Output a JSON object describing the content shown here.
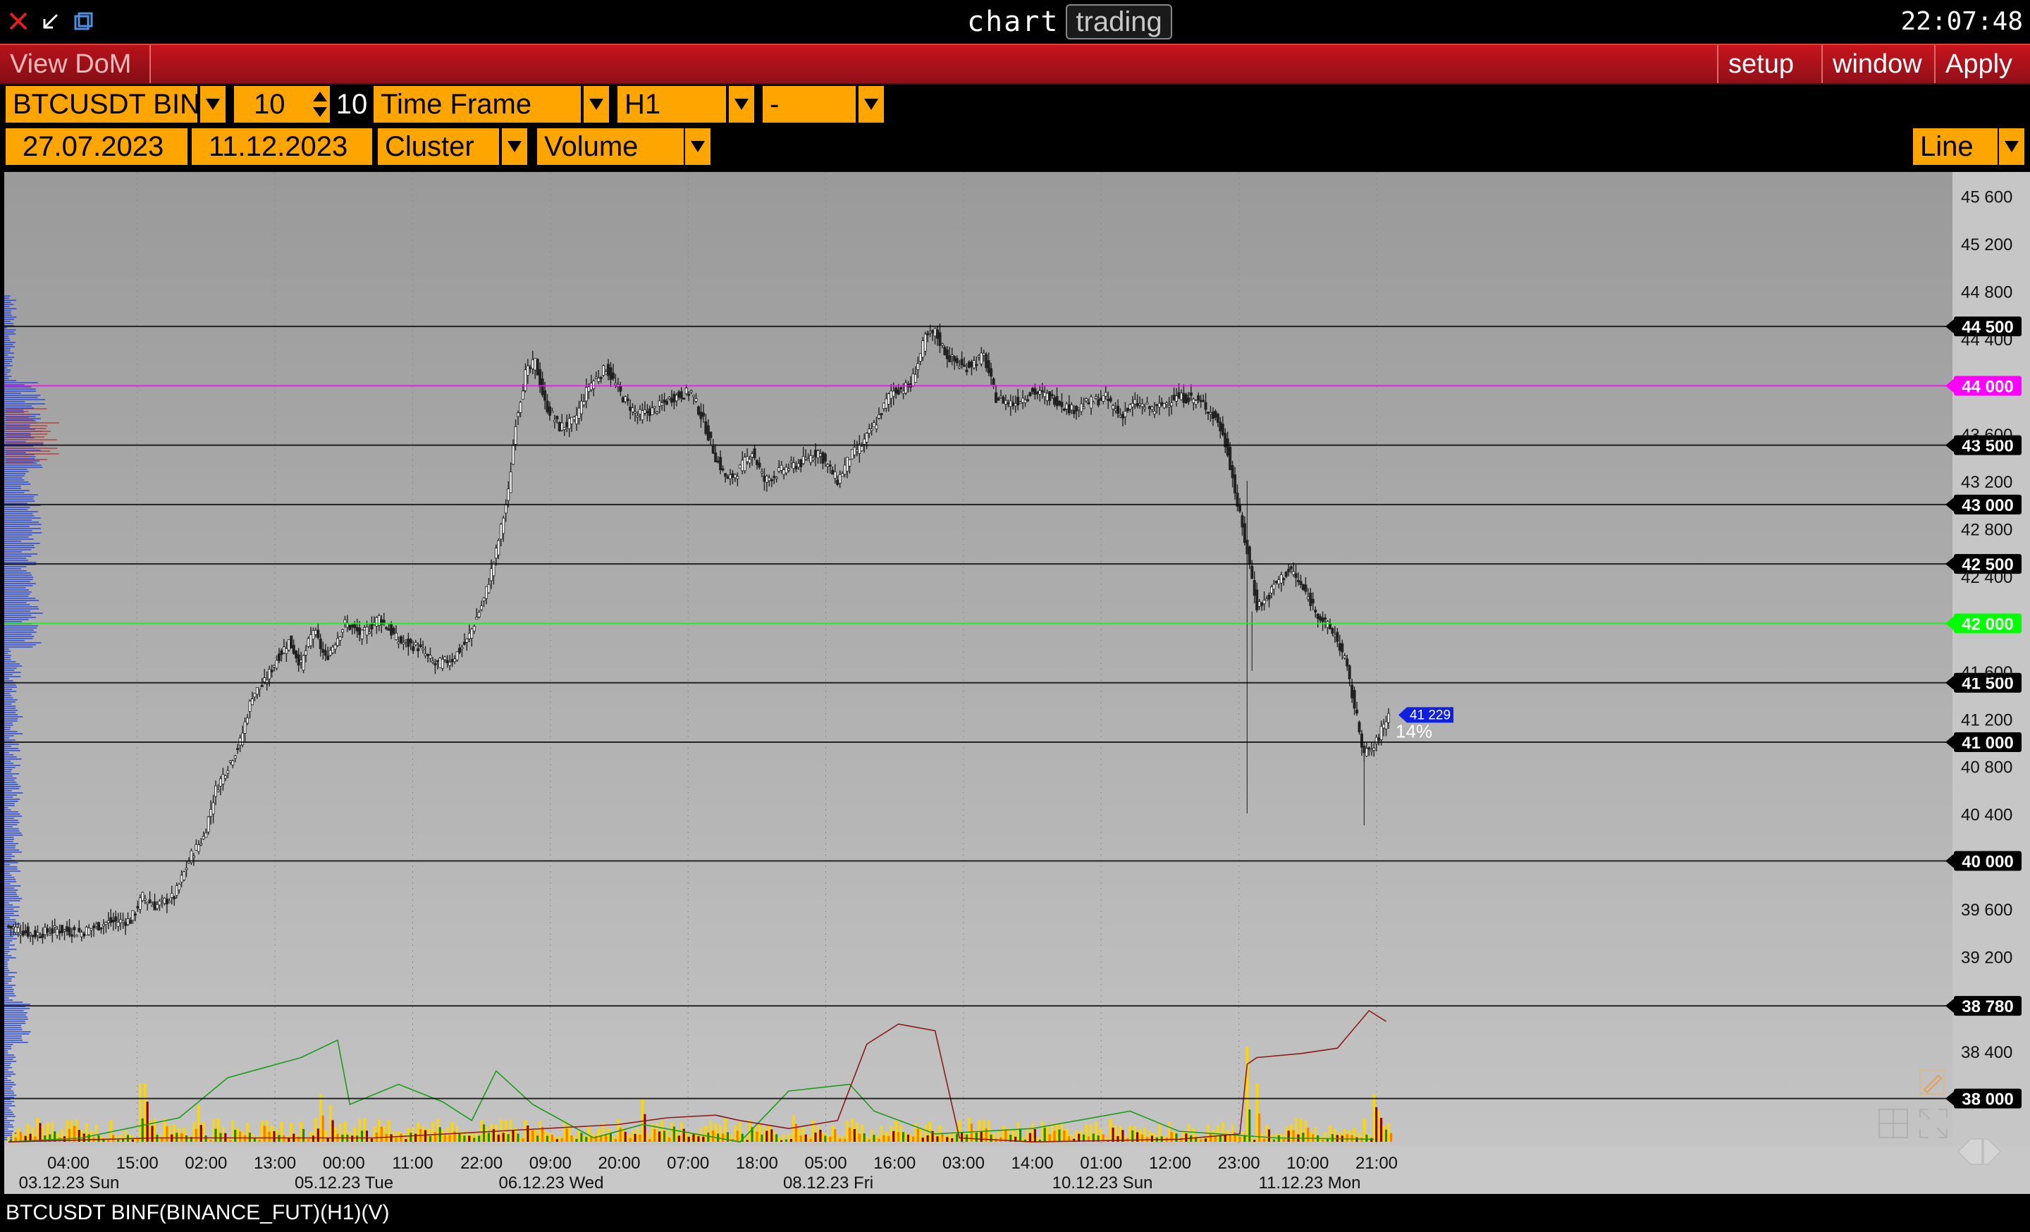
{
  "titlebar": {
    "app_name": "chart",
    "mode_label": "trading",
    "clock": "22:07:48"
  },
  "menubar": {
    "view_dom": "View DoM",
    "setup": "setup",
    "window": "window",
    "apply": "Apply"
  },
  "controls": {
    "symbol": "BTCUSDT BIN",
    "count_value": "10",
    "count_label": "10",
    "timeframe_label": "Time Frame",
    "timeframe_value": "H1",
    "extra_value": "-",
    "date_from": "27.07.2023",
    "date_to": "11.12.2023",
    "chart_type": "Cluster",
    "cluster_mode": "Volume",
    "draw_mode": "Line"
  },
  "status": {
    "caption": "BTCUSDT BINF(BINANCE_FUT)(H1)(V)"
  },
  "chart_data": {
    "type": "candlestick",
    "ylim": [
      37600,
      45800
    ],
    "price_ticks": [
      "45 600",
      "45 200",
      "44 800",
      "44 400",
      "43 600",
      "43 200",
      "42 800",
      "42 400",
      "41 600",
      "41 200",
      "40 800",
      "40 400",
      "39 600",
      "39 200",
      "38 400"
    ],
    "levels": [
      {
        "label": "44 500",
        "value": 44500,
        "color": "#000000"
      },
      {
        "label": "44 000",
        "value": 44000,
        "color": "#ff00ff"
      },
      {
        "label": "43 500",
        "value": 43500,
        "color": "#000000"
      },
      {
        "label": "43 000",
        "value": 43000,
        "color": "#000000"
      },
      {
        "label": "42 500",
        "value": 42500,
        "color": "#000000"
      },
      {
        "label": "42 000",
        "value": 42000,
        "color": "#00ff00"
      },
      {
        "label": "41 500",
        "value": 41500,
        "color": "#000000"
      },
      {
        "label": "41 000",
        "value": 41000,
        "color": "#000000"
      },
      {
        "label": "40 000",
        "value": 40000,
        "color": "#000000"
      },
      {
        "label": "38 780",
        "value": 38780,
        "color": "#000000"
      },
      {
        "label": "38 000",
        "value": 38000,
        "color": "#000000"
      }
    ],
    "current_price_label": "41 229",
    "current_price": 41229,
    "current_pct": "14%",
    "time_ticks": [
      "04:00",
      "15:00",
      "02:00",
      "13:00",
      "00:00",
      "11:00",
      "22:00",
      "09:00",
      "20:00",
      "07:00",
      "18:00",
      "05:00",
      "16:00",
      "03:00",
      "14:00",
      "01:00",
      "12:00",
      "23:00",
      "10:00",
      "21:00"
    ],
    "date_labels": [
      "03.12.23 Sun",
      "05.12.23 Tue",
      "06.12.23 Wed",
      "08.12.23 Fri",
      "10.12.23 Sun",
      "11.12.23 Mon"
    ],
    "close_path": [
      [
        0,
        39450
      ],
      [
        10,
        39380
      ],
      [
        20,
        39420
      ],
      [
        30,
        39400
      ],
      [
        40,
        39480
      ],
      [
        50,
        39500
      ],
      [
        55,
        39700
      ],
      [
        60,
        39620
      ],
      [
        68,
        39700
      ],
      [
        75,
        40050
      ],
      [
        80,
        40200
      ],
      [
        85,
        40600
      ],
      [
        90,
        40800
      ],
      [
        95,
        41000
      ],
      [
        100,
        41400
      ],
      [
        105,
        41500
      ],
      [
        110,
        41700
      ],
      [
        115,
        41850
      ],
      [
        120,
        41650
      ],
      [
        125,
        41950
      ],
      [
        130,
        41700
      ],
      [
        138,
        42000
      ],
      [
        145,
        41900
      ],
      [
        152,
        42050
      ],
      [
        160,
        41850
      ],
      [
        168,
        41800
      ],
      [
        175,
        41650
      ],
      [
        182,
        41700
      ],
      [
        188,
        41850
      ],
      [
        195,
        42200
      ],
      [
        200,
        42600
      ],
      [
        205,
        43100
      ],
      [
        208,
        43700
      ],
      [
        212,
        44100
      ],
      [
        216,
        44200
      ],
      [
        220,
        43850
      ],
      [
        226,
        43650
      ],
      [
        232,
        43700
      ],
      [
        238,
        44000
      ],
      [
        245,
        44150
      ],
      [
        252,
        43900
      ],
      [
        258,
        43750
      ],
      [
        265,
        43800
      ],
      [
        272,
        43900
      ],
      [
        280,
        43950
      ],
      [
        285,
        43700
      ],
      [
        290,
        43400
      ],
      [
        295,
        43200
      ],
      [
        300,
        43300
      ],
      [
        305,
        43450
      ],
      [
        310,
        43200
      ],
      [
        318,
        43300
      ],
      [
        325,
        43350
      ],
      [
        332,
        43450
      ],
      [
        340,
        43200
      ],
      [
        345,
        43400
      ],
      [
        350,
        43500
      ],
      [
        356,
        43700
      ],
      [
        362,
        43950
      ],
      [
        370,
        44000
      ],
      [
        376,
        44400
      ],
      [
        380,
        44450
      ],
      [
        385,
        44250
      ],
      [
        392,
        44150
      ],
      [
        400,
        44250
      ],
      [
        405,
        43900
      ],
      [
        412,
        43850
      ],
      [
        420,
        43950
      ],
      [
        428,
        43900
      ],
      [
        436,
        43800
      ],
      [
        442,
        43850
      ],
      [
        450,
        43900
      ],
      [
        456,
        43750
      ],
      [
        462,
        43850
      ],
      [
        470,
        43800
      ],
      [
        478,
        43900
      ],
      [
        484,
        43900
      ],
      [
        490,
        43850
      ],
      [
        496,
        43700
      ],
      [
        500,
        43450
      ],
      [
        504,
        43000
      ],
      [
        508,
        42600
      ],
      [
        512,
        42150
      ],
      [
        516,
        42200
      ],
      [
        520,
        42350
      ],
      [
        526,
        42450
      ],
      [
        532,
        42250
      ],
      [
        538,
        42050
      ],
      [
        544,
        41900
      ],
      [
        548,
        41700
      ],
      [
        552,
        41300
      ],
      [
        556,
        40900
      ],
      [
        560,
        40950
      ],
      [
        564,
        41150
      ],
      [
        566,
        41229
      ]
    ],
    "volume_spikes": [
      [
        55,
        0.55
      ],
      [
        78,
        0.35
      ],
      [
        128,
        0.45
      ],
      [
        132,
        0.35
      ],
      [
        260,
        0.4
      ],
      [
        322,
        0.25
      ],
      [
        330,
        0.2
      ],
      [
        508,
        0.9
      ],
      [
        512,
        0.55
      ],
      [
        560,
        0.45
      ],
      [
        562,
        0.3
      ]
    ],
    "delta_green": [
      [
        0,
        0.02
      ],
      [
        30,
        0.05
      ],
      [
        70,
        0.2
      ],
      [
        90,
        0.5
      ],
      [
        120,
        0.65
      ],
      [
        135,
        0.78
      ],
      [
        140,
        0.3
      ],
      [
        160,
        0.45
      ],
      [
        178,
        0.32
      ],
      [
        190,
        0.18
      ],
      [
        200,
        0.55
      ],
      [
        215,
        0.3
      ],
      [
        240,
        0.05
      ],
      [
        260,
        0.15
      ],
      [
        300,
        0.02
      ],
      [
        320,
        0.4
      ],
      [
        345,
        0.45
      ],
      [
        355,
        0.25
      ],
      [
        380,
        0.08
      ],
      [
        420,
        0.12
      ],
      [
        460,
        0.25
      ],
      [
        480,
        0.1
      ],
      [
        520,
        0.05
      ],
      [
        560,
        0.04
      ]
    ],
    "delta_red": [
      [
        0,
        0.02
      ],
      [
        60,
        0.05
      ],
      [
        150,
        0.05
      ],
      [
        250,
        0.15
      ],
      [
        270,
        0.2
      ],
      [
        290,
        0.22
      ],
      [
        300,
        0.18
      ],
      [
        320,
        0.12
      ],
      [
        340,
        0.18
      ],
      [
        352,
        0.75
      ],
      [
        365,
        0.9
      ],
      [
        380,
        0.85
      ],
      [
        390,
        0.05
      ],
      [
        420,
        0.02
      ],
      [
        480,
        0.04
      ],
      [
        505,
        0.08
      ],
      [
        508,
        0.6
      ],
      [
        512,
        0.65
      ],
      [
        530,
        0.68
      ],
      [
        545,
        0.72
      ],
      [
        558,
        1.0
      ],
      [
        565,
        0.92
      ]
    ]
  }
}
